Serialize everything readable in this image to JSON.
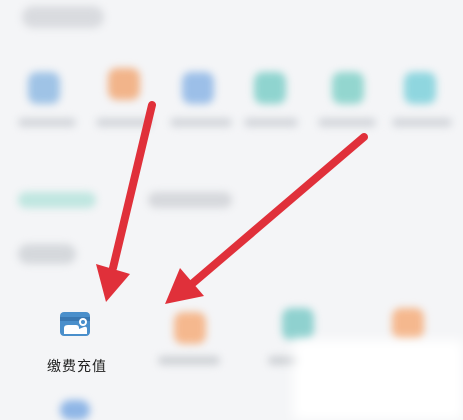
{
  "main_item": {
    "label": "缴费充值",
    "icon": "card-payment-icon"
  },
  "colors": {
    "arrow": "#e0303a",
    "icon_blue": "#4a8fcb"
  }
}
